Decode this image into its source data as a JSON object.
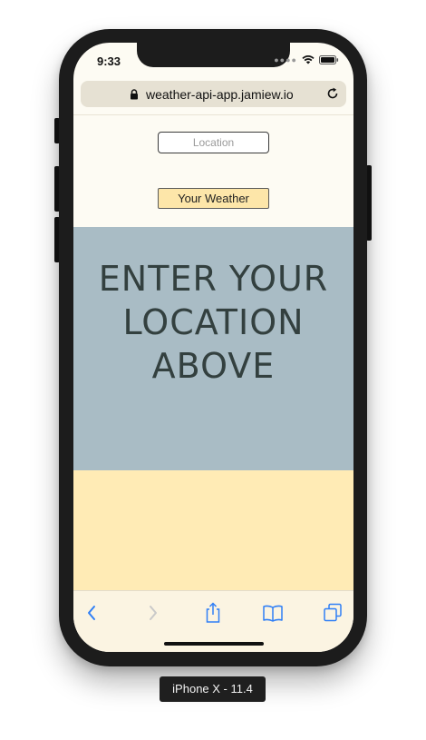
{
  "status_bar": {
    "time": "9:33",
    "signal_icon": "cellular-dots-icon",
    "wifi_icon": "wifi-icon",
    "battery_icon": "battery-icon"
  },
  "browser": {
    "url": "weather-api-app.jamiew.io",
    "lock_icon": "lock-icon",
    "reload_icon": "reload-icon"
  },
  "form": {
    "location_placeholder": "Location",
    "location_value": "",
    "submit_label": "Your Weather"
  },
  "hero": {
    "line1": "ENTER YOUR",
    "line2": "LOCATION",
    "line3": "ABOVE"
  },
  "toolbar": {
    "items": [
      {
        "icon": "back-icon",
        "enabled": true
      },
      {
        "icon": "forward-icon",
        "enabled": false
      },
      {
        "icon": "share-icon",
        "enabled": true
      },
      {
        "icon": "bookmarks-icon",
        "enabled": true
      },
      {
        "icon": "tabs-icon",
        "enabled": true
      }
    ]
  },
  "device_label": "iPhone X - 11.4",
  "colors": {
    "page_background": "#fdfbf3",
    "hero_background": "#a9bcc5",
    "hero_text": "#33403f",
    "button_background": "#fde6a9",
    "result_panel": "#ffebb5",
    "ios_blue": "#2f7ff6"
  }
}
